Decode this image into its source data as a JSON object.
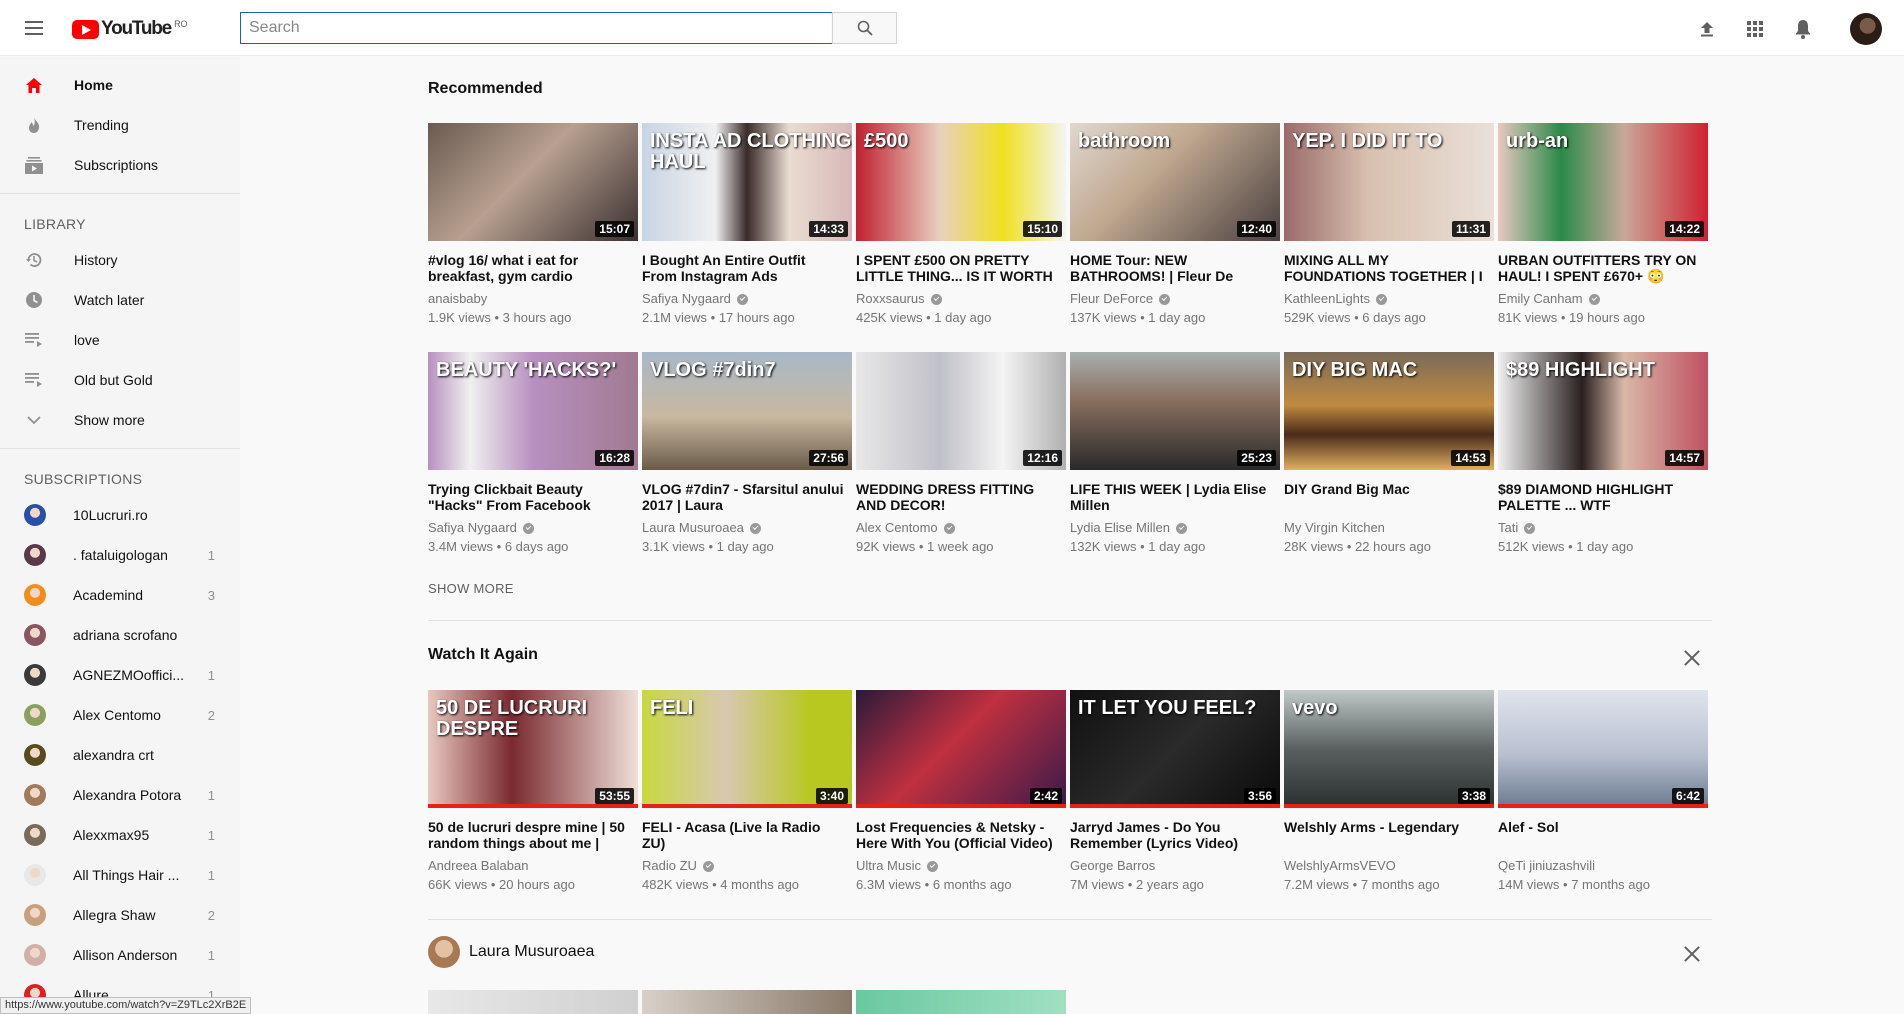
{
  "header": {
    "logo_text": "YouTube",
    "country_code": "RO",
    "search_placeholder": "Search"
  },
  "sidebar": {
    "main_items": [
      {
        "label": "Home",
        "icon": "home-icon",
        "active": true
      },
      {
        "label": "Trending",
        "icon": "flame-icon"
      },
      {
        "label": "Subscriptions",
        "icon": "subscriptions-icon"
      }
    ],
    "library_heading": "LIBRARY",
    "library_items": [
      {
        "label": "History",
        "icon": "history-icon"
      },
      {
        "label": "Watch later",
        "icon": "clock-icon"
      },
      {
        "label": "love",
        "icon": "playlist-icon"
      },
      {
        "label": "Old but Gold",
        "icon": "playlist-icon"
      },
      {
        "label": "Show more",
        "icon": "chevron-down-icon"
      }
    ],
    "subscriptions_heading": "SUBSCRIPTIONS",
    "subscriptions": [
      {
        "name": "10Lucruri.ro",
        "count": "",
        "color": "#2a4fa8"
      },
      {
        "name": ". fataluigologan",
        "count": "1",
        "color": "#5a3a4a"
      },
      {
        "name": "Academind",
        "count": "3",
        "color": "#f28c1a"
      },
      {
        "name": "adriana scrofano",
        "count": "",
        "color": "#8a5560"
      },
      {
        "name": "AGNEZMOoffici...",
        "count": "1",
        "color": "#3a3a3a"
      },
      {
        "name": "Alex Centomo",
        "count": "2",
        "color": "#8aa060"
      },
      {
        "name": "alexandra crt",
        "count": "",
        "color": "#5a4a20"
      },
      {
        "name": "Alexandra Potora",
        "count": "1",
        "color": "#a07a5a"
      },
      {
        "name": "Alexxmax95",
        "count": "1",
        "color": "#7a6a5a"
      },
      {
        "name": "All Things Hair ...",
        "count": "1",
        "color": "#e8e8e8"
      },
      {
        "name": "Allegra Shaw",
        "count": "2",
        "color": "#c8a080"
      },
      {
        "name": "Allison Anderson",
        "count": "1",
        "color": "#d0b0a8"
      },
      {
        "name": "Allure",
        "count": "1",
        "color": "#e02020"
      }
    ]
  },
  "recommended": {
    "title": "Recommended",
    "show_more": "SHOW MORE",
    "videos": [
      {
        "title": "#vlog 16/ what i eat for breakfast, gym cardio",
        "channel": "anaisbaby",
        "verified": false,
        "views": "1.9K views",
        "age": "3 hours ago",
        "duration": "15:07",
        "thumb_text": "",
        "bg": "linear-gradient(135deg,#6a5a50,#b8a090 45%,#3a3030)"
      },
      {
        "title": "I Bought An Entire Outfit From Instagram Ads",
        "channel": "Safiya Nygaard",
        "verified": true,
        "views": "2.1M views",
        "age": "17 hours ago",
        "duration": "14:33",
        "thumb_text": "INSTA AD CLOTHING HAUL",
        "bg": "linear-gradient(90deg,#c8d4e4,#f0f0f0 35%,#3a2a2a 50%,#e8dcd0 70%,#d8b8b8)"
      },
      {
        "title": "I SPENT £500 ON PRETTY LITTLE THING... IS IT WORTH",
        "channel": "Roxxsaurus",
        "verified": true,
        "views": "425K views",
        "age": "1 day ago",
        "duration": "15:10",
        "thumb_text": "£500",
        "bg": "linear-gradient(90deg,#c02030,#e8d0c0 40%,#f0e020 70%,#f4f4f4)"
      },
      {
        "title": "HOME Tour: NEW BATHROOMS! | Fleur De",
        "channel": "Fleur DeForce",
        "verified": true,
        "views": "137K views",
        "age": "1 day ago",
        "duration": "12:40",
        "thumb_text": "bathroom",
        "bg": "linear-gradient(135deg,#e0d8d0,#c0a890 40%,#4a4040)"
      },
      {
        "title": "MIXING ALL MY FOUNDATIONS TOGETHER | I",
        "channel": "KathleenLights",
        "verified": true,
        "views": "529K views",
        "age": "6 days ago",
        "duration": "11:31",
        "thumb_text": "YEP. I DID IT TO",
        "bg": "linear-gradient(90deg,#9a6a6a,#d8c0b0 40%,#eae0d8)"
      },
      {
        "title": "URBAN OUTFITTERS TRY ON HAUL! I SPENT £670+ 😳",
        "channel": "Emily Canham",
        "verified": true,
        "views": "81K views",
        "age": "19 hours ago",
        "duration": "14:22",
        "thumb_text": "urb-an",
        "bg": "linear-gradient(90deg,#e8c8c0,#2a8a4a 30%,#c8a898 60%,#d02030)"
      },
      {
        "title": "Trying Clickbait Beauty \"Hacks\" From Facebook",
        "channel": "Safiya Nygaard",
        "verified": true,
        "views": "3.4M views",
        "age": "6 days ago",
        "duration": "16:28",
        "thumb_text": "BEAUTY 'HACKS?'",
        "bg": "linear-gradient(90deg,#b890c0,#f0f0f0 20%,#b890c0 50%,#a07a90)"
      },
      {
        "title": "VLOG #7din7 - Sfarsitul anului 2017 | Laura",
        "channel": "Laura Musuroaea",
        "verified": true,
        "views": "3.1K views",
        "age": "1 day ago",
        "duration": "27:56",
        "thumb_text": "VLOG #7din7",
        "bg": "linear-gradient(180deg,#a8b8c8,#c8b8a0 55%,#6a5a4a)"
      },
      {
        "title": "WEDDING DRESS FITTING AND DECOR!",
        "channel": "Alex Centomo",
        "verified": true,
        "views": "92K views",
        "age": "1 week ago",
        "duration": "12:16",
        "thumb_text": "",
        "bg": "linear-gradient(90deg,#e8e8e8,#c0c0c8 40%,#f4f4f4 70%,#b0b0b0)"
      },
      {
        "title": "LIFE THIS WEEK | Lydia Elise Millen",
        "channel": "Lydia Elise Millen",
        "verified": true,
        "views": "132K views",
        "age": "1 day ago",
        "duration": "25:23",
        "thumb_text": "",
        "bg": "linear-gradient(180deg,#a8b0b0,#8a7060 40%,#2a2a2a)"
      },
      {
        "title": "DIY Grand Big Mac",
        "channel": "My Virgin Kitchen",
        "verified": false,
        "views": "28K views",
        "age": "22 hours ago",
        "duration": "14:53",
        "thumb_text": "DIY BIG MAC",
        "bg": "linear-gradient(180deg,#7a6a5a,#c08a40 45%,#4a2a1a 70%,#e0b060)"
      },
      {
        "title": "$89 DIAMOND HIGHLIGHT PALETTE ... WTF",
        "channel": "Tati",
        "verified": true,
        "views": "512K views",
        "age": "1 day ago",
        "duration": "14:57",
        "thumb_text": "$89 HIGHLIGHT",
        "bg": "linear-gradient(90deg,#f0f0f0,#2a2020 40%,#d8b8a8 60%,#c05060)"
      }
    ]
  },
  "watch_again": {
    "title": "Watch It Again",
    "videos": [
      {
        "title": "50 de lucruri despre mine | 50 random things about me |",
        "channel": "Andreea Balaban",
        "verified": false,
        "views": "66K views",
        "age": "20 hours ago",
        "duration": "53:55",
        "thumb_text": "50 DE LUCRURI DESPRE",
        "bg": "linear-gradient(90deg,#e8c8c0,#7a2a30 40%,#f0e0d8)"
      },
      {
        "title": "FELI - Acasa (Live la Radio ZU)",
        "channel": "Radio ZU",
        "verified": true,
        "views": "482K views",
        "age": "4 months ago",
        "duration": "3:40",
        "thumb_text": "FELI",
        "bg": "linear-gradient(90deg,#c8d840,#d8c8b0 40%,#b8c820 80%)"
      },
      {
        "title": "Lost Frequencies & Netsky - Here With You (Official Video)",
        "channel": "Ultra Music",
        "verified": true,
        "views": "6.3M views",
        "age": "6 months ago",
        "duration": "2:42",
        "thumb_text": "",
        "bg": "linear-gradient(135deg,#2a1a3a,#c03040 45%,#3a1a4a)"
      },
      {
        "title": "Jarryd James - Do You Remember (Lyrics Video)",
        "channel": "George Barros",
        "verified": false,
        "views": "7M views",
        "age": "2 years ago",
        "duration": "3:56",
        "thumb_text": "IT LET YOU FEEL?",
        "bg": "linear-gradient(135deg,#101010,#2a2a2a 50%,#0a0a0a)"
      },
      {
        "title": "Welshly Arms - Legendary",
        "channel": "WelshlyArmsVEVO",
        "verified": false,
        "views": "7.2M views",
        "age": "7 months ago",
        "duration": "3:38",
        "thumb_text": "vevo",
        "bg": "linear-gradient(180deg,#c0c8c8,#5a6060 50%,#2a3030)"
      },
      {
        "title": "Alef - Sol",
        "channel": "QeTi jiniuzashvili",
        "verified": false,
        "views": "14M views",
        "age": "7 months ago",
        "duration": "6:42",
        "thumb_text": "",
        "bg": "linear-gradient(180deg,#e0e4ec,#b8c0d0 55%,#6a7890)"
      }
    ]
  },
  "channel_section": {
    "name": "Laura Musuroaea"
  },
  "status_url": "https://www.youtube.com/watch?v=Z9TLc2XrB2E"
}
